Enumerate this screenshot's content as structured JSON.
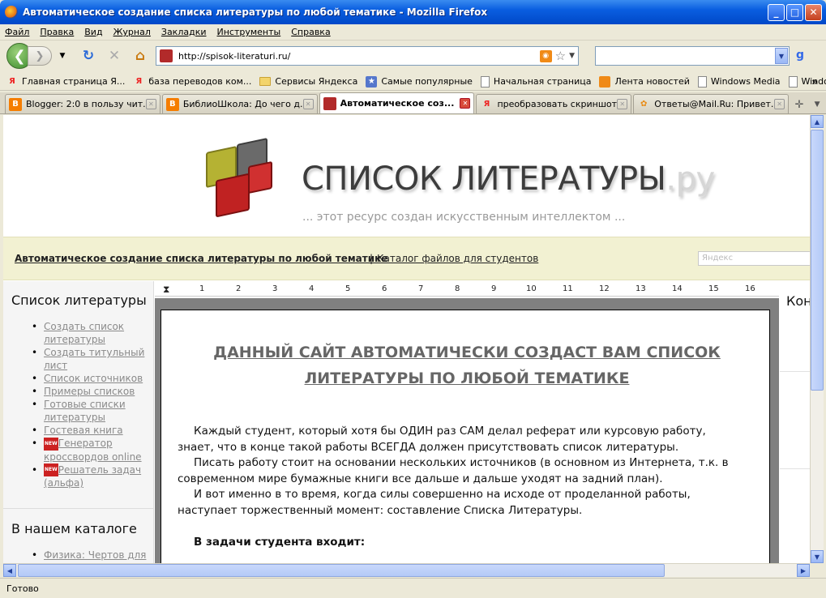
{
  "window": {
    "title": "Автоматическое создание списка литературы по любой тематике - Mozilla Firefox",
    "minimize": "_",
    "maximize": "□",
    "close": "✕"
  },
  "menu": [
    "Файл",
    "Правка",
    "Вид",
    "Журнал",
    "Закладки",
    "Инструменты",
    "Справка"
  ],
  "nav": {
    "url": "http://spisok-literaturi.ru/",
    "search_value": ""
  },
  "bookmarks": [
    {
      "label": "Главная страница Я...",
      "icon": "yandex-icon"
    },
    {
      "label": "база переводов ком...",
      "icon": "yandex-icon"
    },
    {
      "label": "Сервисы Яндекса",
      "icon": "folder-icon"
    },
    {
      "label": "Самые популярные",
      "icon": "star-folder-icon"
    },
    {
      "label": "Начальная страница",
      "icon": "page-icon"
    },
    {
      "label": "Лента новостей",
      "icon": "feed-icon"
    },
    {
      "label": "Windows Media",
      "icon": "page-icon"
    },
    {
      "label": "Windows",
      "icon": "page-icon"
    }
  ],
  "tabs": [
    {
      "label": "Blogger: 2:0 в пользу чит...",
      "icon": "blogger-icon",
      "color": "#f57d00",
      "active": false
    },
    {
      "label": "БиблиоШкола: До чего д...",
      "icon": "blogger-icon",
      "color": "#f57d00",
      "active": false
    },
    {
      "label": "Автоматическое соз...",
      "icon": "book-icon",
      "color": "#b22a2a",
      "active": true
    },
    {
      "label": "преобразовать скриншот...",
      "icon": "yandex-icon",
      "color": "#ffffff",
      "active": false
    },
    {
      "label": "Ответы@Mail.Ru: Привет...",
      "icon": "mailru-icon",
      "color": "#ffffff",
      "active": false
    }
  ],
  "page": {
    "site_title": "СПИСОК ЛИТЕРАТУРЫ",
    "site_title_suffix": ".ру",
    "tagline": "... этот ресурс создан искусственным интеллектом ...",
    "link_main": "Автоматическое создание списка литературы по любой тематике",
    "link_sep": "|",
    "link_catalog": "Каталог файлов для студентов",
    "search_placeholder": "Яндекс",
    "sidebar": {
      "heading1": "Список литературы",
      "items": [
        {
          "label": "Создать список литературы",
          "new": false
        },
        {
          "label": "Создать титульный лист",
          "new": false
        },
        {
          "label": "Список источников",
          "new": false
        },
        {
          "label": "Примеры списков",
          "new": false
        },
        {
          "label": "Готовые списки литературы",
          "new": false
        },
        {
          "label": "Гостевая книга",
          "new": false
        },
        {
          "label": "Генератор кроссвордов online",
          "new": true
        },
        {
          "label": "Решатель задач (альфа)",
          "new": true
        }
      ],
      "new_badge": "NEW",
      "heading2": "В нашем каталоге",
      "catalog_items": [
        "Физика: Чертов для"
      ]
    },
    "ruler_numbers": [
      "1",
      "2",
      "3",
      "4",
      "5",
      "6",
      "7",
      "8",
      "9",
      "10",
      "11",
      "12",
      "13",
      "14",
      "15",
      "16"
    ],
    "doc": {
      "title": "ДАННЫЙ САЙТ АВТОМАТИЧЕСКИ СОЗДАСТ ВАМ СПИСОК ЛИТЕРАТУРЫ ПО ЛЮБОЙ ТЕМАТИКЕ",
      "p1": "Каждый студент, который хотя бы ОДИН раз САМ делал реферат или курсовую работу, знает, что в конце такой работы ВСЕГДА должен присутствовать список литературы.",
      "p2": "Писать работу стоит на основании нескольких источников (в основном из Интернета, т.к. в современном мире бумажные книги все дальше и дальше уходят на задний план).",
      "p3": "И вот именно в то время, когда силы совершенно на исходе от проделанной работы, наступает торжественный момент: составление Списка Литературы.",
      "p4": "В задачи студента входит:"
    },
    "right_heading": "Кон"
  },
  "status": "Готово"
}
